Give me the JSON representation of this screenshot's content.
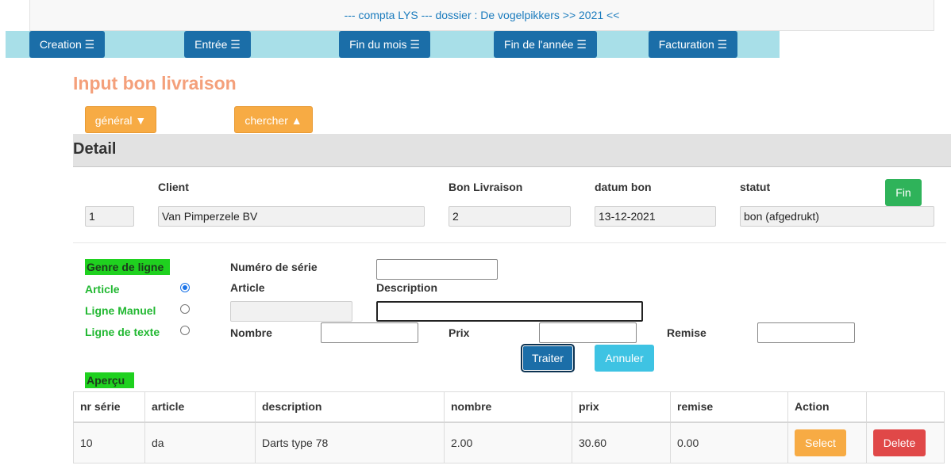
{
  "header": {
    "breadcrumb": "--- compta LYS --- dossier : De vogelpikkers >> 2021 <<"
  },
  "nav": {
    "items": [
      "Creation ☰",
      "Entrée ☰",
      "Fin du mois ☰",
      "Fin de l'année ☰",
      "Facturation ☰"
    ]
  },
  "page": {
    "title": "Input bon livraison",
    "general_button": "général ▼",
    "chercher_button": "chercher ▲"
  },
  "detail": {
    "heading": "Detail",
    "labels": {
      "client": "Client",
      "bon_livraison": "Bon Livraison",
      "datum_bon": "datum bon",
      "statut": "statut"
    },
    "values": {
      "id": "1",
      "client": "Van Pimperzele BV",
      "bon_livraison": "2",
      "datum_bon": "13-12-2021",
      "statut": "bon (afgedrukt)"
    },
    "fin_button": "Fin"
  },
  "line_form": {
    "genre_label": "Genre de ligne",
    "options": [
      "Article",
      "Ligne Manuel",
      "Ligne de texte"
    ],
    "selected_option": "Article",
    "labels": {
      "numero_serie": "Numéro de série",
      "article": "Article",
      "description": "Description",
      "nombre": "Nombre",
      "prix": "Prix",
      "remise": "Remise"
    },
    "values": {
      "numero_serie": "",
      "article": "",
      "description": "",
      "nombre": "",
      "prix": "",
      "remise": ""
    },
    "traiter_button": "Traiter",
    "annuler_button": "Annuler"
  },
  "apercu": {
    "label": "Aperçu",
    "columns": [
      "nr série",
      "article",
      "description",
      "nombre",
      "prix",
      "remise",
      "Action",
      ""
    ],
    "rows": [
      {
        "nr_serie": "10",
        "article": "da",
        "description": "Darts type 78",
        "nombre": "2.00",
        "prix": "30.60",
        "remise": "0.00",
        "select_label": "Select",
        "delete_label": "Delete"
      }
    ]
  },
  "colors": {
    "nav_button": "#1b6ea8",
    "nav_bar": "#a8dfe8",
    "title": "#f4a07b",
    "orange_button": "#f7ab44",
    "green_button": "#2fb35a",
    "red_button": "#e04848",
    "cyan_button": "#3ec3e3",
    "green_label": "#1fd11f"
  }
}
